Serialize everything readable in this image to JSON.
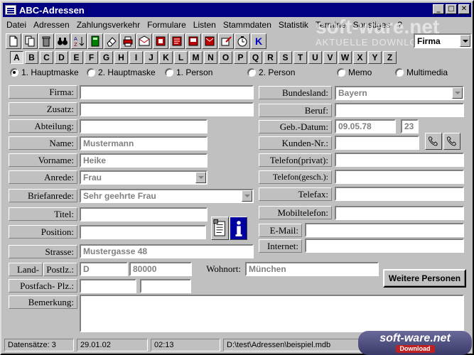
{
  "window": {
    "title": "ABC-Adressen"
  },
  "menu": [
    "Datei",
    "Adressen",
    "Zahlungsverkehr",
    "Formulare",
    "Listen",
    "Stammdaten",
    "Statistik",
    "Termine",
    "Sonstiges",
    "?"
  ],
  "toolbar": {
    "icons": [
      "new-document-icon",
      "copy-document-icon",
      "trash-icon",
      "binoculars-icon",
      "sort-az-icon",
      "calculator-icon",
      "eraser-icon",
      "printer-icon",
      "envelope-icon",
      "label-icon",
      "letter-icon",
      "fax-icon",
      "email-icon",
      "notepad-icon",
      "clock-icon",
      "k-icon"
    ],
    "k_label": "K",
    "search_combo_value": "Firma"
  },
  "alphabet": [
    "A",
    "B",
    "C",
    "D",
    "E",
    "F",
    "G",
    "H",
    "I",
    "J",
    "K",
    "L",
    "M",
    "N",
    "O",
    "P",
    "Q",
    "R",
    "S",
    "T",
    "U",
    "V",
    "W",
    "X",
    "Y",
    "Z"
  ],
  "radios": [
    {
      "label": "1. Hauptmaske",
      "checked": true
    },
    {
      "label": "2. Hauptmaske",
      "checked": false
    },
    {
      "label": "1. Person",
      "checked": false
    },
    {
      "label": "2. Person",
      "checked": false
    },
    {
      "label": "Memo",
      "checked": false
    },
    {
      "label": "Multimedia",
      "checked": false
    }
  ],
  "left_fields": {
    "firma": {
      "label": "Firma:",
      "value": ""
    },
    "zusatz": {
      "label": "Zusatz:",
      "value": ""
    },
    "abteilung": {
      "label": "Abteilung:",
      "value": ""
    },
    "name": {
      "label": "Name:",
      "value": "Mustermann"
    },
    "vorname": {
      "label": "Vorname:",
      "value": "Heike"
    },
    "anrede": {
      "label": "Anrede:",
      "value": "Frau"
    },
    "briefanrede": {
      "label": "Briefanrede:",
      "value": "Sehr geehrte Frau"
    },
    "titel": {
      "label": "Titel:",
      "value": ""
    },
    "position": {
      "label": "Position:",
      "value": ""
    },
    "strasse": {
      "label": "Strasse:",
      "value": "Mustergasse 48"
    },
    "land": {
      "label": "Land-",
      "value": "D"
    },
    "postlz": {
      "label": "Postlz.:",
      "value": "80000"
    },
    "wohnort": {
      "label": "Wohnort:",
      "value": "München"
    },
    "postfach": {
      "label": "Postfach- Plz.:",
      "value": "",
      "value2": ""
    },
    "bemerkung": {
      "label": "Bemerkung:",
      "value": ""
    }
  },
  "right_fields": {
    "bundesland": {
      "label": "Bundesland:",
      "value": "Bayern"
    },
    "beruf": {
      "label": "Beruf:",
      "value": ""
    },
    "geb_datum": {
      "label": "Geb.-Datum:",
      "value": "09.05.78",
      "age": "23"
    },
    "kunden_nr": {
      "label": "Kunden-Nr.:",
      "value": ""
    },
    "telefon_privat": {
      "label": "Telefon(privat):",
      "value": ""
    },
    "telefon_gesch": {
      "label": "Telefon(gesch.):",
      "value": ""
    },
    "telefax": {
      "label": "Telefax:",
      "value": ""
    },
    "mobiltelefon": {
      "label": "Mobiltelefon:",
      "value": ""
    },
    "email": {
      "label": "E-Mail:",
      "value": ""
    },
    "internet": {
      "label": "Internet:",
      "value": ""
    }
  },
  "buttons": {
    "weitere_personen": "Weitere Personen"
  },
  "status": {
    "datensaetze": "Datensätze: 3",
    "date": "29.01.02",
    "time": "02:13",
    "path": "D:\\test\\Adressen\\beispiel.mdb"
  },
  "watermark": {
    "top_text": "soft-ware.net",
    "top_sub": "AKTUELLE DOWNLOADS",
    "bottom_text": "soft-ware.net",
    "bottom_sub": "Download"
  },
  "colors": {
    "titlebar": "#000080",
    "face": "#c0c0c0",
    "value_text": "#808080"
  }
}
